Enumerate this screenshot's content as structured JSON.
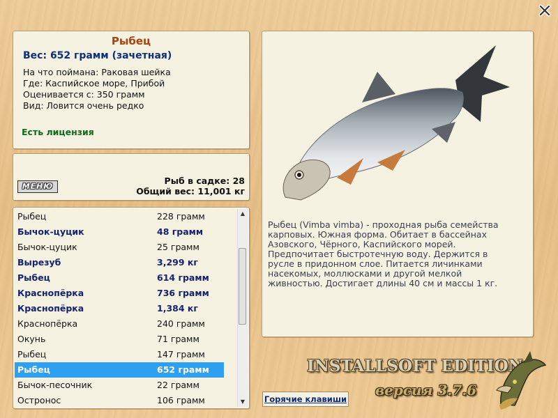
{
  "info": {
    "fish_name": "Рыбец",
    "weight_line": "Вес: 652 грамм (зачетная)",
    "caught_on": "На что поймана: Раковая шейка",
    "location": "Где: Каспийское море, Прибой",
    "rated_from": "Оценивается с: 350 грамм",
    "kind": "Вид: Ловится очень редко",
    "license": "Есть лицензия"
  },
  "stats": {
    "menu_label": "МЕНЮ",
    "fish_in_keepnet": "Рыб в садке: 28",
    "total_weight": "Общий вес: 11,001 кг"
  },
  "catch_list": [
    {
      "name": "Рыбец",
      "weight": "228 грамм",
      "bold": false,
      "selected": false
    },
    {
      "name": "Бычок-цуцик",
      "weight": "48 грамм",
      "bold": true,
      "selected": false
    },
    {
      "name": "Бычок-цуцик",
      "weight": "25 грамм",
      "bold": false,
      "selected": false
    },
    {
      "name": "Вырезуб",
      "weight": "3,299 кг",
      "bold": true,
      "selected": false
    },
    {
      "name": "Рыбец",
      "weight": "614 грамм",
      "bold": true,
      "selected": false
    },
    {
      "name": "Краснопёрка",
      "weight": "736 грамм",
      "bold": true,
      "selected": false
    },
    {
      "name": "Краснопёрка",
      "weight": "1,384 кг",
      "bold": true,
      "selected": false
    },
    {
      "name": "Краснопёрка",
      "weight": "240 грамм",
      "bold": false,
      "selected": false
    },
    {
      "name": "Окунь",
      "weight": "71 грамм",
      "bold": false,
      "selected": false
    },
    {
      "name": "Рыбец",
      "weight": "147 грамм",
      "bold": false,
      "selected": false
    },
    {
      "name": "Рыбец",
      "weight": "652 грамм",
      "bold": false,
      "selected": true
    },
    {
      "name": "Бычок-песочник",
      "weight": "22 грамм",
      "bold": false,
      "selected": false
    },
    {
      "name": "Остронос",
      "weight": "106 грамм",
      "bold": false,
      "selected": false
    }
  ],
  "description": "Рыбец (Vimba vimba) - проходная рыба семейства карповых. Южная форма. Обитает в бассейнах Азовского, Чёрного, Каспийского морей. Предпочитает быстротечную воду. Держится в русле в придонном слое. Питается личинками насекомых, моллюсками и другой мелкой живностью. Достигает длины 40 см и массы 1 кг.",
  "hotkeys_label": "Горячие клавиши",
  "brand": {
    "edition": "INSTALLSOFT EDITION",
    "version": "версия 3.7.6"
  },
  "icons": {
    "close": "close-icon",
    "fish_photo": "fish-image",
    "pike_logo": "pike-logo-icon"
  },
  "colors": {
    "title": "#a84410",
    "weight": "#0f2f7a",
    "license": "#0d6a1a",
    "selection": "#2f9ff0"
  }
}
